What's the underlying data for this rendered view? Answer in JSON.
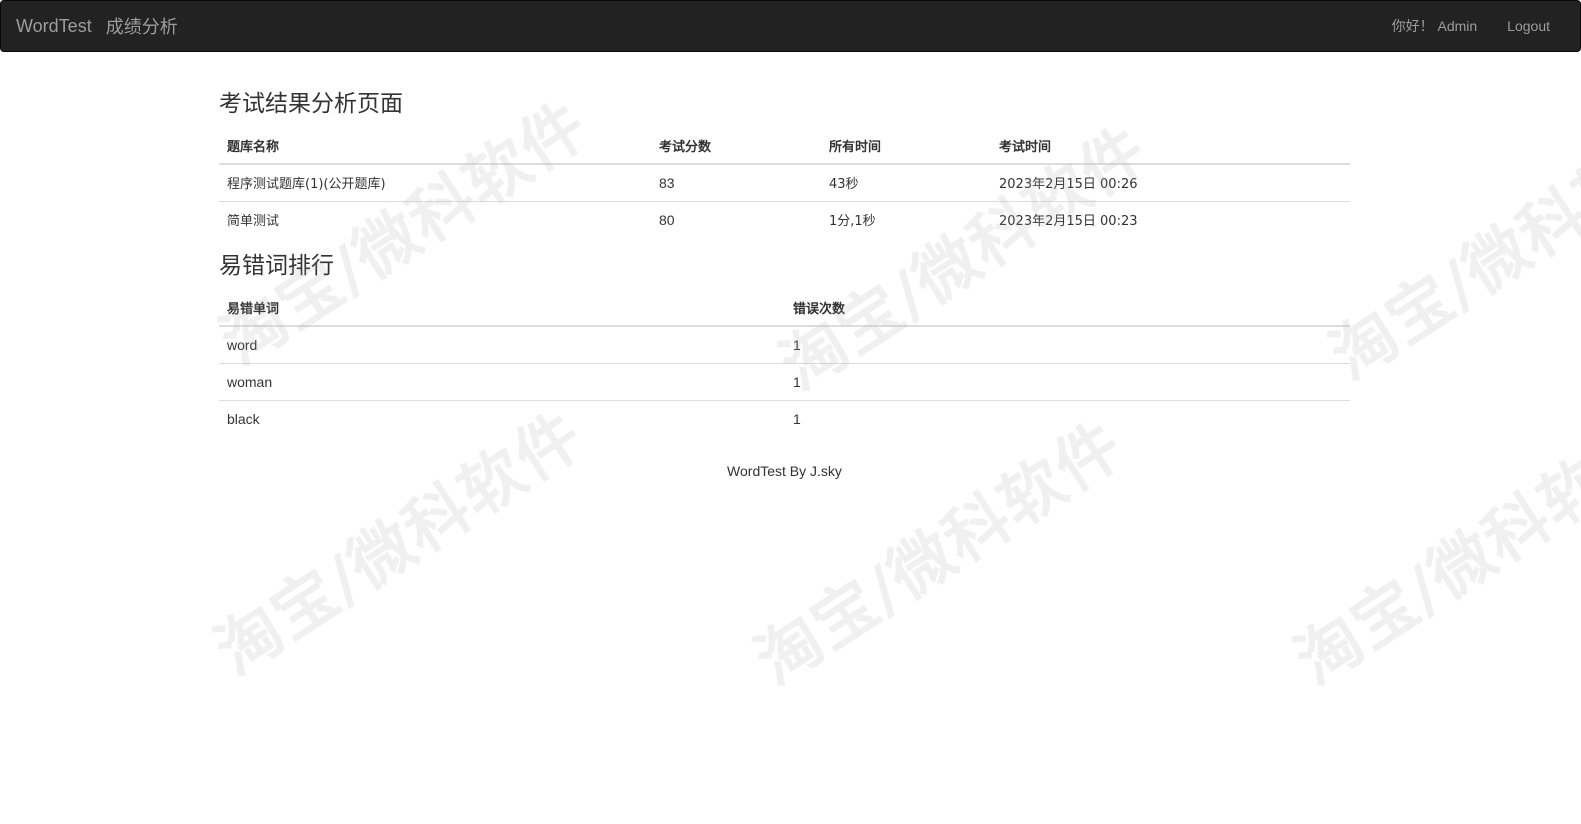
{
  "navbar": {
    "brand": "WordTest",
    "page_link": "成绩分析",
    "greeting": "你好！ Admin",
    "logout": "Logout"
  },
  "results": {
    "title": "考试结果分析页面",
    "headers": [
      "题库名称",
      "考试分数",
      "所有时间",
      "考试时间"
    ],
    "rows": [
      [
        "程序测试题库(1)(公开题库)",
        "83",
        "43秒",
        "2023年2月15日 00:26"
      ],
      [
        "简单测试",
        "80",
        "1分,1秒",
        "2023年2月15日 00:23"
      ]
    ]
  },
  "mistakes": {
    "title": "易错词排行",
    "headers": [
      "易错单词",
      "错误次数"
    ],
    "rows": [
      [
        "word",
        "1"
      ],
      [
        "woman",
        "1"
      ],
      [
        "black",
        "1"
      ]
    ]
  },
  "footer": {
    "text": "WordTest By J.sky"
  },
  "watermark": {
    "text": "淘宝/微科软件"
  }
}
